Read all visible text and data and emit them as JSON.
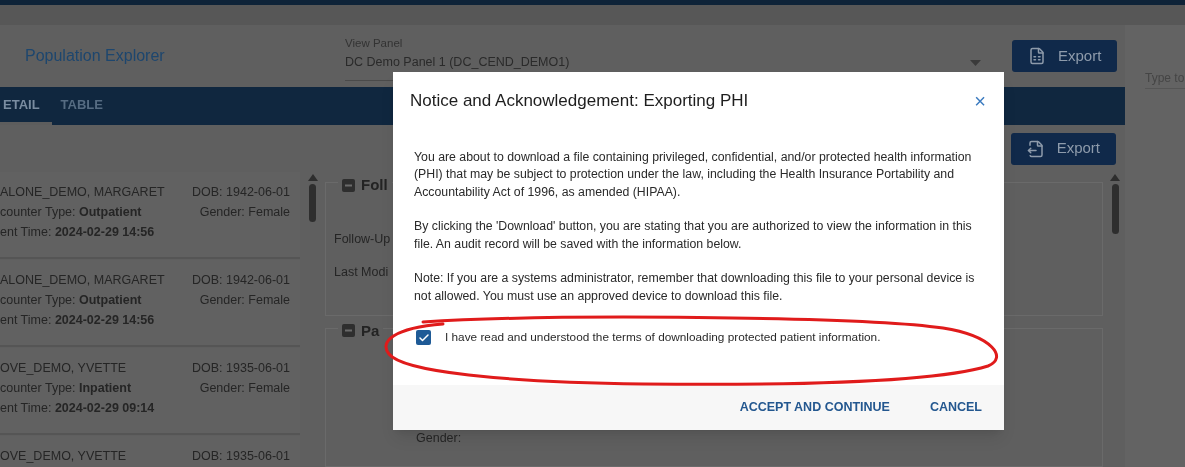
{
  "header": {
    "title": "Population Explorer",
    "view_panel": {
      "label": "View Panel",
      "value": "DC Demo Panel 1 (DC_CEND_DEMO1)"
    },
    "export_button": "Export"
  },
  "search": {
    "placeholder": "Type to"
  },
  "tabs": [
    {
      "label": "ETAIL",
      "selected": true
    },
    {
      "label": "TABLE",
      "selected": false
    }
  ],
  "toolbar": {
    "export_button": "Export"
  },
  "patients": [
    {
      "name": "ALONE_DEMO, MARGARET",
      "dob": "DOB: 1942-06-01",
      "encounter_type": "counter Type: **Outpatient**",
      "gender": "Gender: Female",
      "time": "ent Time: **2024-02-29 14:56**"
    },
    {
      "name": "ALONE_DEMO, MARGARET",
      "dob": "DOB: 1942-06-01",
      "encounter_type": "counter Type: **Outpatient**",
      "gender": "Gender: Female",
      "time": "ent Time: **2024-02-29 14:56**"
    },
    {
      "name": "OVE_DEMO, YVETTE",
      "dob": "DOB: 1935-06-01",
      "encounter_type": "counter Type: **Inpatient**",
      "gender": "Gender: Female",
      "time": "ent Time: **2024-02-29 09:14**"
    },
    {
      "name": "OVE_DEMO, YVETTE",
      "dob": "DOB: 1935-06-01"
    }
  ],
  "sections": [
    {
      "title": "Foll",
      "fields": [
        "Follow-Up",
        "Last Modi"
      ]
    },
    {
      "title": "Pa",
      "fields": [
        "Gender:"
      ]
    }
  ],
  "dialog": {
    "title": "Notice and Acknowledgement: Exporting PHI",
    "close": "×",
    "paragraphs": [
      "You are about to download a file containing privileged, confidential, and/or protected health information (PHI) that may be subject to protection under the law, including the Health Insurance Portability and Accountability Act of 1996, as amended (HIPAA).",
      "By clicking the 'Download' button, you are stating that you are authorized to view the information in this file. An audit record will be saved with the information below.",
      "Note: If you are a systems administrator, remember that downloading this file to your personal device is not allowed. You must use an approved device to download this file."
    ],
    "checkbox": {
      "label": "I have read and understood the terms of downloading protected patient information.",
      "checked": true
    },
    "buttons": [
      "ACCEPT AND CONTINUE",
      "CANCEL"
    ]
  }
}
